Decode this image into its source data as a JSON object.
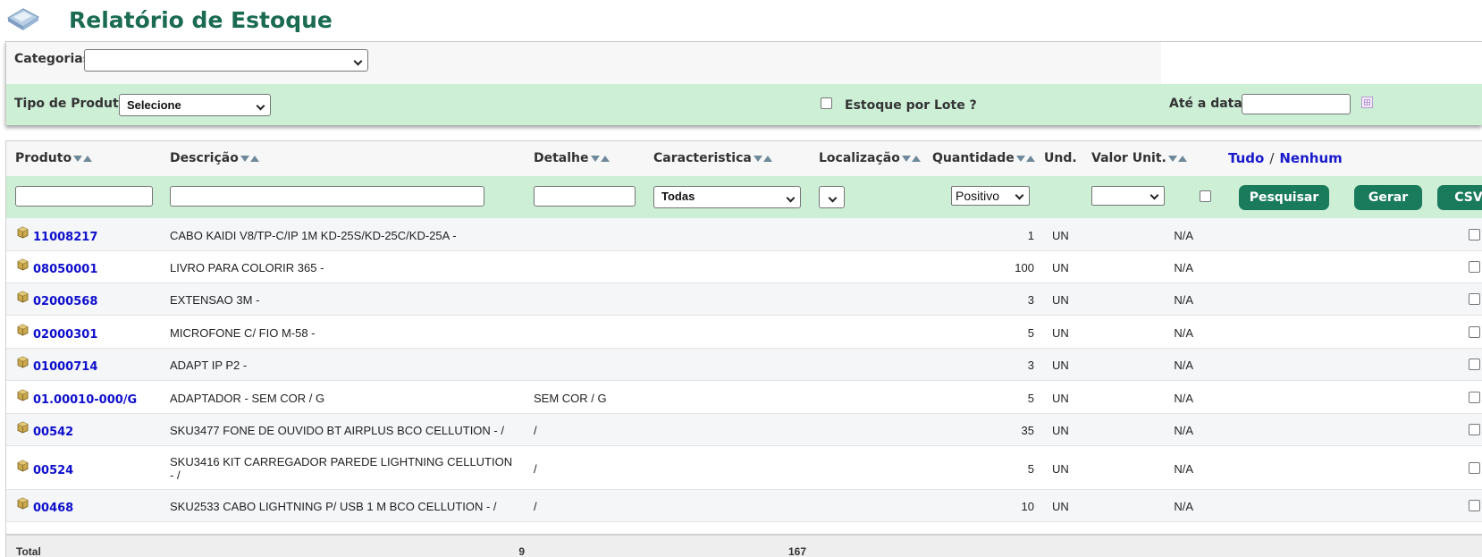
{
  "header": {
    "title": "Relatório de Estoque",
    "logo_icon": "folder-icon"
  },
  "filters": {
    "categorias_label": "Categorias",
    "categorias_value": "",
    "tipo_produto_label": "Tipo de Produto",
    "tipo_produto_value": "Selecione",
    "estoque_lote_label": "Estoque por Lote ?",
    "estoque_lote_checked": false,
    "ate_data_label": "Até a data",
    "ate_data_value": "",
    "calendar_icon": "calendar-icon"
  },
  "table": {
    "columns": {
      "produto": "Produto",
      "descricao": "Descrição",
      "detalhe": "Detalhe",
      "caracteristica": "Caracteristica",
      "localizacao": "Localização",
      "quantidade": "Quantidade",
      "und": "Und.",
      "valor_unit": "Valor Unit."
    },
    "select_all": "Tudo",
    "select_separator": "/",
    "select_none": "Nenhum",
    "filter_inputs": {
      "caracteristica_value": "Todas",
      "localizacao_value": "",
      "quantidade_value": "Positivo",
      "valor_unit_value": ""
    },
    "buttons": {
      "pesquisar": "Pesquisar",
      "gerar": "Gerar",
      "csv": "CSV"
    },
    "rows": [
      {
        "code": "11008217",
        "description": "CABO KAIDI V8/TP-C/IP 1M KD-25S/KD-25C/KD-25A -",
        "detail": "",
        "quantity": "1",
        "unit": "UN",
        "value": "N/A"
      },
      {
        "code": "08050001",
        "description": "LIVRO PARA COLORIR 365 -",
        "detail": "",
        "quantity": "100",
        "unit": "UN",
        "value": "N/A"
      },
      {
        "code": "02000568",
        "description": "EXTENSAO 3M -",
        "detail": "",
        "quantity": "3",
        "unit": "UN",
        "value": "N/A"
      },
      {
        "code": "02000301",
        "description": "MICROFONE C/ FIO M-58 -",
        "detail": "",
        "quantity": "5",
        "unit": "UN",
        "value": "N/A"
      },
      {
        "code": "01000714",
        "description": "ADAPT IP P2 -",
        "detail": "",
        "quantity": "3",
        "unit": "UN",
        "value": "N/A"
      },
      {
        "code": "01.00010-000/G",
        "description": "ADAPTADOR - SEM COR / G",
        "detail": "SEM COR / G",
        "quantity": "5",
        "unit": "UN",
        "value": "N/A"
      },
      {
        "code": "00542",
        "description": "SKU3477 FONE DE OUVIDO BT AIRPLUS BCO CELLUTION - /",
        "detail": "/",
        "quantity": "35",
        "unit": "UN",
        "value": "N/A"
      },
      {
        "code": "00524",
        "description": "SKU3416 KIT CARREGADOR PAREDE LIGHTNING CELLUTION - /",
        "detail": "/",
        "quantity": "5",
        "unit": "UN",
        "value": "N/A"
      },
      {
        "code": "00468",
        "description": "SKU2533 CABO LIGHTNING P/ USB 1 M BCO CELLUTION - /",
        "detail": "/",
        "quantity": "10",
        "unit": "UN",
        "value": "N/A"
      }
    ],
    "total": {
      "label": "Total",
      "count": "9",
      "quantity": "167"
    },
    "row_icon": "product-box-icon"
  },
  "colors": {
    "brand": "#1a7a5c",
    "title": "#1a6b52",
    "filter_bg": "#ccefd6",
    "link": "#0f0fcc"
  }
}
